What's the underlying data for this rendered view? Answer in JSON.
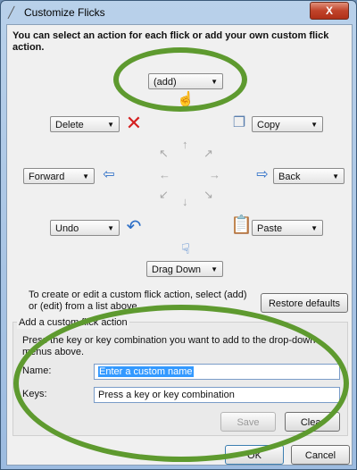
{
  "window": {
    "title": "Customize Flicks",
    "close_label": "X"
  },
  "instructions": "You can select an action for each flick or add your own custom flick action.",
  "flicks": {
    "up": {
      "value": "(add)"
    },
    "up_left": {
      "value": "Delete"
    },
    "up_right": {
      "value": "Copy"
    },
    "left": {
      "value": "Forward"
    },
    "right": {
      "value": "Back"
    },
    "down_left": {
      "value": "Undo"
    },
    "down_right": {
      "value": "Paste"
    },
    "down": {
      "value": "Drag Down"
    }
  },
  "custom_help": "To create or edit a custom flick action, select (add) or (edit) from a list above.",
  "restore_label": "Restore defaults",
  "group": {
    "title": "Add a custom flick action",
    "instructions": "Press the key or key combination you want to add to the drop-down menus above.",
    "name_label": "Name:",
    "name_value": "Enter a custom name",
    "keys_label": "Keys:",
    "keys_value": "Press a key or key combination",
    "save_label": "Save",
    "clear_label": "Clear"
  },
  "ok_label": "OK",
  "cancel_label": "Cancel",
  "colors": {
    "highlight_ellipse": "#5e9a2f"
  }
}
